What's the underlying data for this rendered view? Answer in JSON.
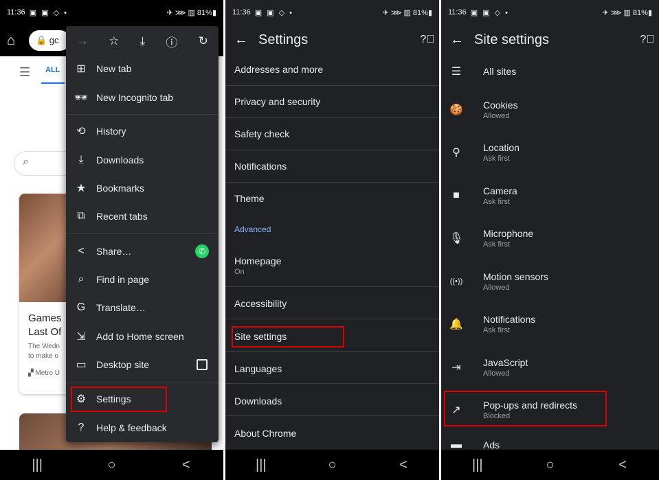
{
  "panel1": {
    "status": {
      "time": "11:36",
      "icons": "▣ ▣ ◇ •",
      "right": "✈ ⋙ ▥ 81%▮"
    },
    "toolbar": {
      "home_icon": "⌂",
      "url_text": "🔒 gc"
    },
    "page": {
      "tab_all": "ALL",
      "card_title": "Games\nLast Of",
      "card_title_line1": "Games",
      "card_title_line2": "Last Of",
      "card_sub_line1": "The Wedn",
      "card_sub_line2": "to make o",
      "card_source": "Metro U"
    },
    "menu": {
      "top_icons": [
        "→",
        "☆",
        "⤓",
        "ⓘ",
        "↻"
      ],
      "items": [
        {
          "label": "New tab",
          "icon": "⊞"
        },
        {
          "label": "New Incognito tab",
          "icon": "🕶"
        },
        {
          "label": "History",
          "icon": "⟲"
        },
        {
          "label": "Downloads",
          "icon": "⤓"
        },
        {
          "label": "Bookmarks",
          "icon": "★"
        },
        {
          "label": "Recent tabs",
          "icon": "⧉"
        },
        {
          "label": "Share…",
          "icon": "<"
        },
        {
          "label": "Find in page",
          "icon": "⌕"
        },
        {
          "label": "Translate…",
          "icon": "G"
        },
        {
          "label": "Add to Home screen",
          "icon": "⇲"
        },
        {
          "label": "Desktop site",
          "icon": "▭"
        },
        {
          "label": "Settings",
          "icon": "⚙"
        },
        {
          "label": "Help & feedback",
          "icon": "?"
        }
      ]
    },
    "nav": {
      "recents": "|||",
      "home": "○",
      "back": "<"
    }
  },
  "panel2": {
    "status": {
      "time": "11:36",
      "icons": "▣ ▣ ◇ •",
      "right": "✈ ⋙ ▥ 81%▮"
    },
    "title": "Settings",
    "rows": [
      {
        "label": "Addresses and more"
      },
      {
        "label": "Privacy and security"
      },
      {
        "label": "Safety check"
      },
      {
        "label": "Notifications"
      },
      {
        "label": "Theme"
      }
    ],
    "advanced_label": "Advanced",
    "rows2": [
      {
        "label": "Homepage",
        "sub": "On"
      },
      {
        "label": "Accessibility"
      },
      {
        "label": "Site settings"
      },
      {
        "label": "Languages"
      },
      {
        "label": "Downloads"
      },
      {
        "label": "About Chrome"
      }
    ]
  },
  "panel3": {
    "status": {
      "time": "11:36",
      "icons": "▣ ▣ ◇ •",
      "right": "✈ ⋙ ▥ 81%▮"
    },
    "title": "Site settings",
    "items": [
      {
        "label": "All sites",
        "sub": "",
        "icon": "☰"
      },
      {
        "label": "Cookies",
        "sub": "Allowed",
        "icon": "🍪"
      },
      {
        "label": "Location",
        "sub": "Ask first",
        "icon": "⚲"
      },
      {
        "label": "Camera",
        "sub": "Ask first",
        "icon": "■"
      },
      {
        "label": "Microphone",
        "sub": "Ask first",
        "icon": "🎙"
      },
      {
        "label": "Motion sensors",
        "sub": "Allowed",
        "icon": "((•))"
      },
      {
        "label": "Notifications",
        "sub": "Ask first",
        "icon": "🔔"
      },
      {
        "label": "JavaScript",
        "sub": "Allowed",
        "icon": "⇥"
      },
      {
        "label": "Pop-ups and redirects",
        "sub": "Blocked",
        "icon": "↗"
      },
      {
        "label": "Ads",
        "sub": "",
        "icon": "▬"
      }
    ]
  },
  "colors": {
    "highlight": "#e00000",
    "dark_bg": "#202124",
    "menu_bg": "#292a2d",
    "accent": "#8ab4f8"
  }
}
